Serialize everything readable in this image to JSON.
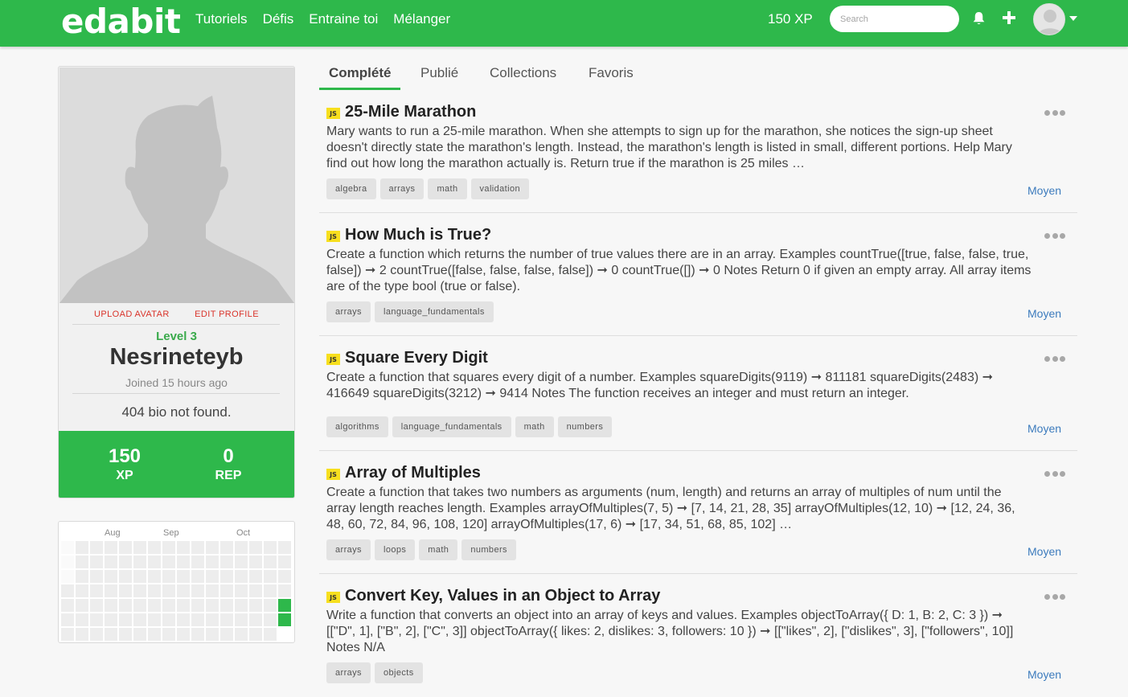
{
  "brand": {
    "logo": "edabit",
    "accent": "#2eb84b"
  },
  "nav": {
    "items": [
      {
        "label": "Tutoriels"
      },
      {
        "label": "Défis"
      },
      {
        "label": "Entraine toi"
      },
      {
        "label": "Mélanger"
      }
    ],
    "xp": "150 XP",
    "search_placeholder": "Search",
    "icons": [
      "bell-icon",
      "plus-icon",
      "avatar",
      "chevron-down-icon"
    ]
  },
  "profile": {
    "upload_avatar": "UPLOAD AVATAR",
    "edit_profile": "EDIT PROFILE",
    "level": "Level 3",
    "username": "Nesrineteyb",
    "joined": "Joined 15 hours ago",
    "bio": "404 bio not found.",
    "stats": [
      {
        "value": "150",
        "label": "XP"
      },
      {
        "value": "0",
        "label": "REP"
      }
    ]
  },
  "activity": {
    "months": [
      "Aug",
      "Sep",
      "Oct"
    ]
  },
  "tabs": [
    {
      "label": "Complété",
      "active": true
    },
    {
      "label": "Publié",
      "active": false
    },
    {
      "label": "Collections",
      "active": false
    },
    {
      "label": "Favoris",
      "active": false
    }
  ],
  "challenges": [
    {
      "lang": "JS",
      "title": "25-Mile Marathon",
      "description": "Mary wants to run a 25-mile marathon. When she attempts to sign up for the marathon, she notices the sign-up sheet doesn't directly state the marathon's length. Instead, the marathon's length is listed in small, different portions. Help Mary find out how long the marathon actually is. Return true if the marathon is 25 miles …",
      "tags": [
        "algebra",
        "arrays",
        "math",
        "validation"
      ],
      "difficulty": "Moyen"
    },
    {
      "lang": "JS",
      "title": "How Much is True?",
      "description": "Create a function which returns the number of true values there are in an array. Examples countTrue([true, false, false, true, false]) ➞ 2 countTrue([false, false, false, false]) ➞ 0 countTrue([]) ➞ 0 Notes Return 0 if given an empty array. All array items are of the type bool (true or false).",
      "tags": [
        "arrays",
        "language_fundamentals"
      ],
      "difficulty": "Moyen"
    },
    {
      "lang": "JS",
      "title": "Square Every Digit",
      "description": "Create a function that squares every digit of a number. Examples squareDigits(9119) ➞ 811181 squareDigits(2483) ➞ 416649 squareDigits(3212) ➞ 9414 Notes The function receives an integer and must return an integer.",
      "tags": [
        "algorithms",
        "language_fundamentals",
        "math",
        "numbers"
      ],
      "difficulty": "Moyen"
    },
    {
      "lang": "JS",
      "title": "Array of Multiples",
      "description": "Create a function that takes two numbers as arguments (num, length) and returns an array of multiples of num until the array length reaches length. Examples arrayOfMultiples(7, 5) ➞ [7, 14, 21, 28, 35] arrayOfMultiples(12, 10) ➞ [12, 24, 36, 48, 60, 72, 84, 96, 108, 120] arrayOfMultiples(17, 6) ➞ [17, 34, 51, 68, 85, 102] …",
      "tags": [
        "arrays",
        "loops",
        "math",
        "numbers"
      ],
      "difficulty": "Moyen"
    },
    {
      "lang": "JS",
      "title": "Convert Key, Values in an Object to Array",
      "description": "Write a function that converts an object into an array of keys and values. Examples objectToArray({ D: 1, B: 2, C: 3 }) ➞ [[\"D\", 1], [\"B\", 2], [\"C\", 3]] objectToArray({ likes: 2, dislikes: 3, followers: 10 }) ➞ [[\"likes\", 2], [\"dislikes\", 3], [\"followers\", 10]] Notes N/A",
      "tags": [
        "arrays",
        "objects"
      ],
      "difficulty": "Moyen"
    }
  ]
}
